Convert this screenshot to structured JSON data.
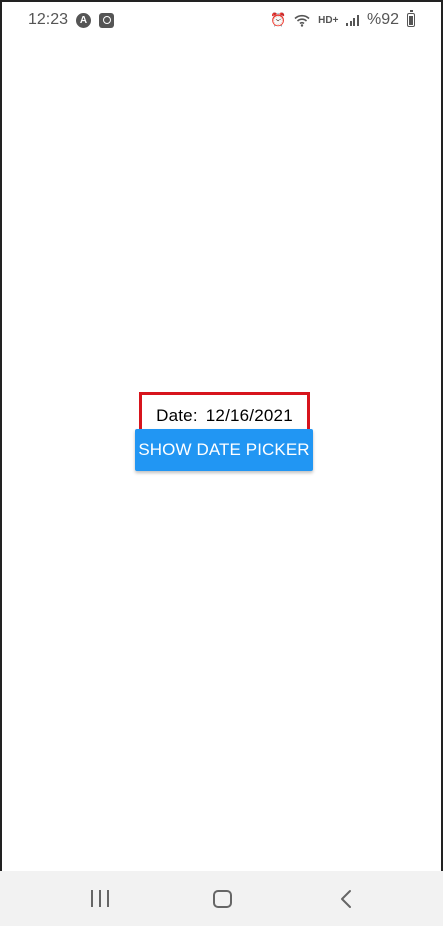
{
  "status_bar": {
    "time": "12:23",
    "app_icon_a": "A",
    "hd_label": "HD+",
    "battery_text": "%92",
    "icons": [
      "alarm-icon",
      "wifi-icon",
      "signal-icon",
      "battery-icon"
    ]
  },
  "main": {
    "date_label": "Date:",
    "date_value": "12/16/2021",
    "button_label": "SHOW DATE PICKER"
  },
  "colors": {
    "button": "#2196f3",
    "highlight_border": "#d7141c",
    "nav_bg": "#f2f2f2"
  },
  "nav_bar": {
    "icons": [
      "recent-apps-icon",
      "home-icon",
      "back-icon"
    ]
  }
}
